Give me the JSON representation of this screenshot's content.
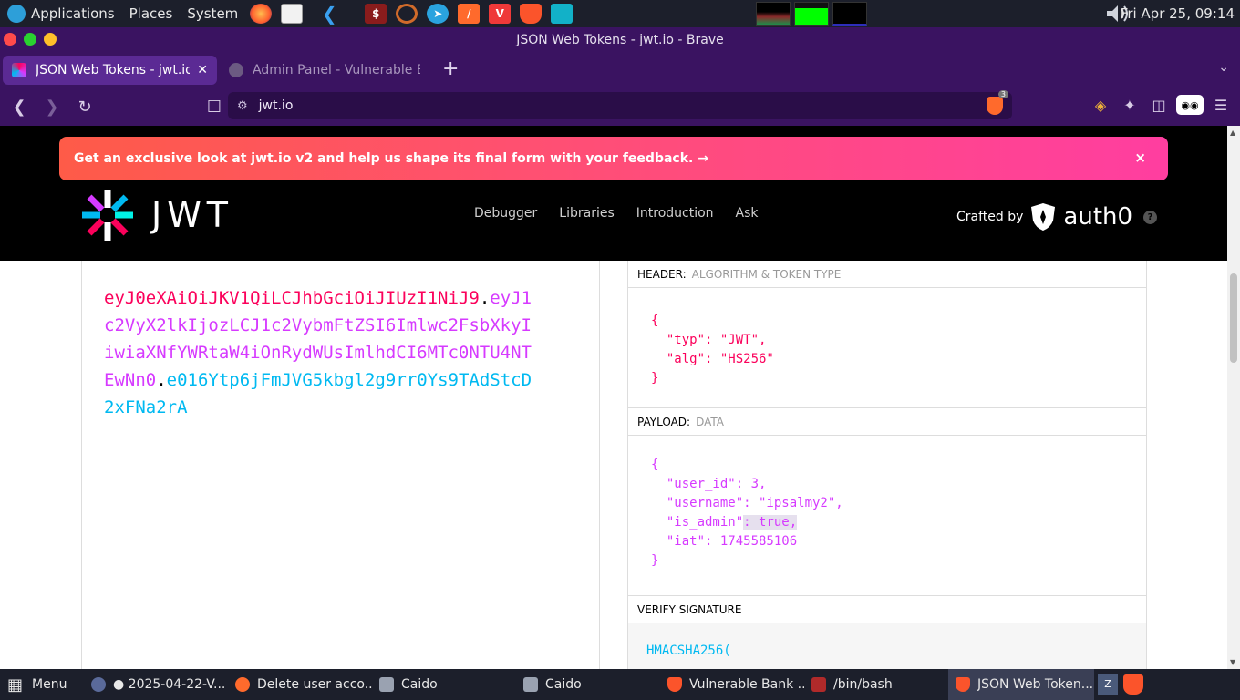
{
  "system_panel": {
    "menus": [
      "Applications",
      "Places",
      "System"
    ],
    "clock": "Fri Apr 25, 09:14"
  },
  "window": {
    "title": "JSON Web Tokens - jwt.io - Brave"
  },
  "tabs": [
    {
      "label": "JSON Web Tokens - jwt.io",
      "active": true
    },
    {
      "label": "Admin Panel - Vulnerable Bank",
      "active": false
    }
  ],
  "toolbar": {
    "url": "jwt.io",
    "shields_count": "3"
  },
  "page": {
    "promo_text": "Get an exclusive look at jwt.io v2 and help us shape its final form with your feedback.  →",
    "promo_close": "×",
    "logo_text": "JWT",
    "nav": [
      "Debugger",
      "Libraries",
      "Introduction",
      "Ask"
    ],
    "crafted_by": "Crafted by",
    "auth0": "auth0",
    "help": "?"
  },
  "encoded": {
    "header": "eyJ0eXAiOiJKV1QiLCJhbGciOiJIUzI1NiJ9",
    "payload": "eyJ1c2VyX2lkIjozLCJ1c2VybmFtZSI6Imlwc2FsbXkyIiwiaXNfYWRtaW4iOnRydWUsImlhdCI6MTc0NTU4NTEwNn0",
    "signature": "e016Ytp6jFmJVG5kbgl2g9rr0Ys9TAdStcD2xFNa2rA",
    "dot": "."
  },
  "decoded": {
    "header_label": "HEADER:",
    "header_sub": "ALGORITHM & TOKEN TYPE",
    "header_lines": [
      "{",
      "  \"typ\": \"JWT\",",
      "  \"alg\": \"HS256\"",
      "}"
    ],
    "payload_label": "PAYLOAD:",
    "payload_sub": "DATA",
    "payload_lines": [
      "{",
      "  \"user_id\": 3,",
      "  \"username\": \"ipsalmy2\",",
      "  \"is_admin\": true,",
      "  \"iat\": 1745585106",
      "}"
    ],
    "verify_label": "VERIFY SIGNATURE",
    "verify_first_line": "HMACSHA256("
  },
  "taskbar": {
    "menu": "Menu",
    "items": [
      {
        "label": "● 2025-04-22-V...",
        "color": "#5a6a9a"
      },
      {
        "label": "Delete user acco...",
        "color": "#ff6a2c"
      },
      {
        "label": "Caido",
        "color": "#9aa2b1"
      },
      {
        "label": "Caido",
        "color": "#9aa2b1"
      },
      {
        "label": "Vulnerable Bank ...",
        "color": "#fb542b"
      },
      {
        "label": "/bin/bash",
        "color": "#b02a2a"
      },
      {
        "label": "JSON Web Token...",
        "color": "#fb542b"
      }
    ]
  }
}
